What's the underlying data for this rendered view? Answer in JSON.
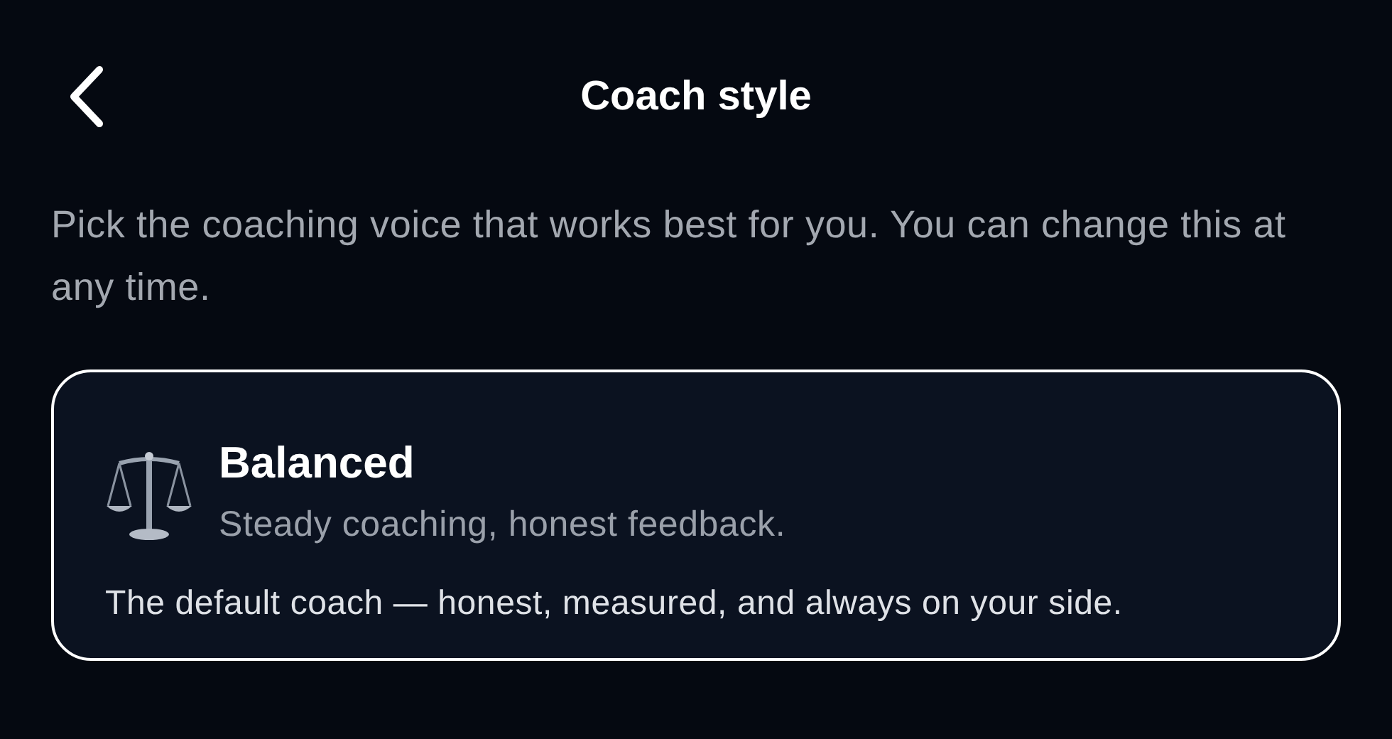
{
  "header": {
    "title": "Coach style"
  },
  "intro": "Pick the coaching voice that works best for you. You can change this at any time.",
  "options": [
    {
      "name": "Balanced",
      "tagline": "Steady coaching, honest feedback.",
      "description": "The default coach — honest, measured, and always on your side.",
      "selected": true
    }
  ]
}
